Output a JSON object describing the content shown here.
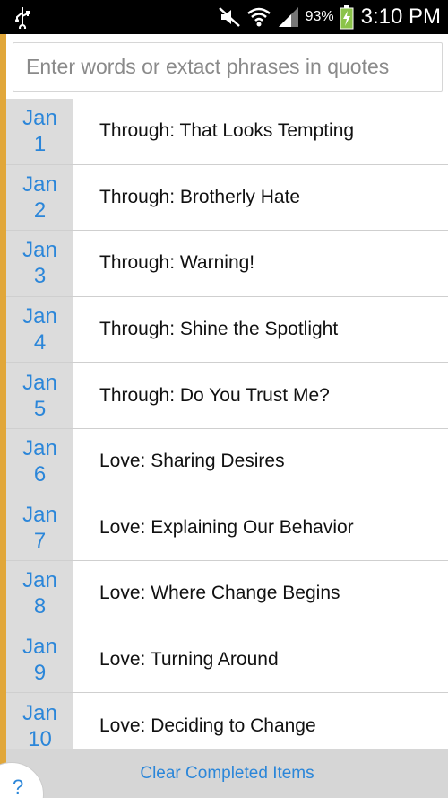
{
  "status_bar": {
    "battery_percent": "93%",
    "time": "3:10 PM",
    "icons": [
      "usb-icon",
      "mute-icon",
      "wifi-icon",
      "signal-icon",
      "battery-charging-icon"
    ]
  },
  "search": {
    "placeholder": "Enter words or extact phrases in quotes"
  },
  "items": [
    {
      "month": "Jan",
      "day": "1",
      "title": "Through: That Looks Tempting"
    },
    {
      "month": "Jan",
      "day": "2",
      "title": "Through: Brotherly Hate"
    },
    {
      "month": "Jan",
      "day": "3",
      "title": "Through: Warning!"
    },
    {
      "month": "Jan",
      "day": "4",
      "title": "Through: Shine the Spotlight"
    },
    {
      "month": "Jan",
      "day": "5",
      "title": "Through: Do You Trust Me?"
    },
    {
      "month": "Jan",
      "day": "6",
      "title": "Love: Sharing Desires"
    },
    {
      "month": "Jan",
      "day": "7",
      "title": "Love: Explaining Our Behavior"
    },
    {
      "month": "Jan",
      "day": "8",
      "title": "Love: Where Change Begins"
    },
    {
      "month": "Jan",
      "day": "9",
      "title": "Love: Turning Around"
    },
    {
      "month": "Jan",
      "day": "10",
      "title": "Love: Deciding to Change"
    }
  ],
  "bottom": {
    "clear_label": "Clear Completed Items",
    "help_label": "?"
  },
  "colors": {
    "accent": "#e1a73a",
    "link": "#2b86d9",
    "date_bg": "#dcdcdc"
  }
}
